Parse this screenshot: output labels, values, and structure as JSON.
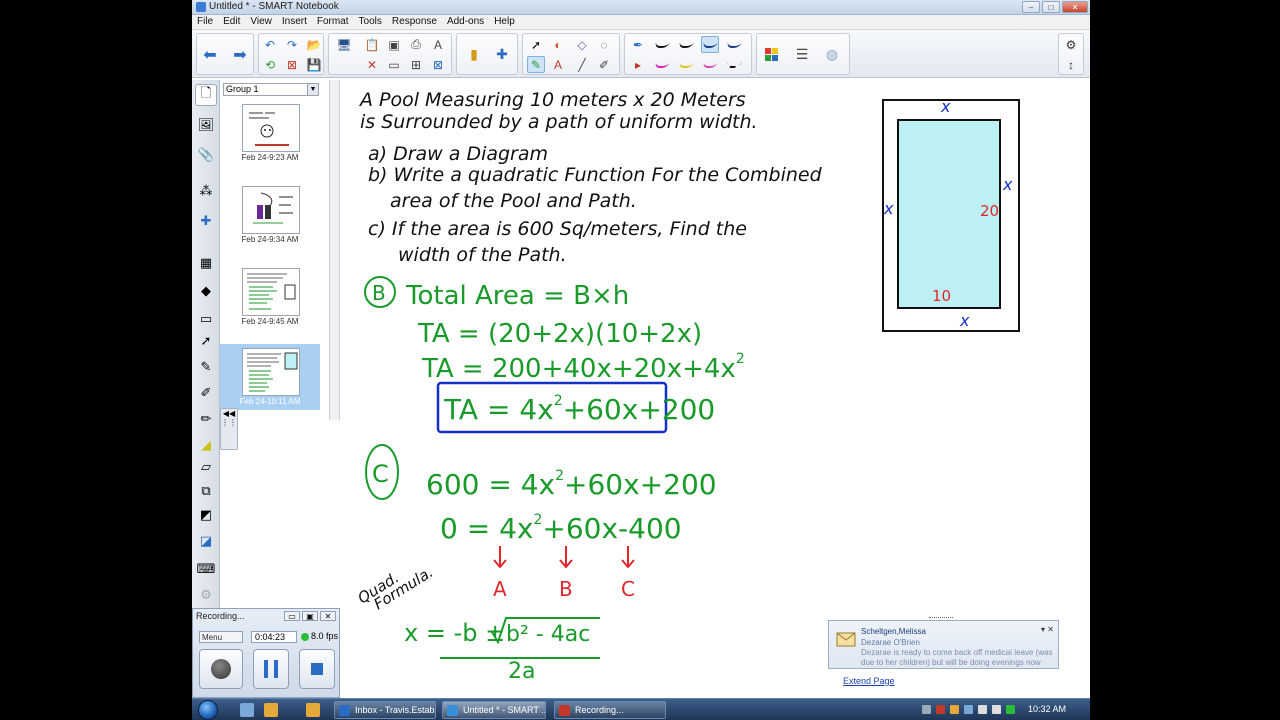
{
  "window": {
    "title": "Untitled * - SMART Notebook",
    "minimize": "–",
    "maximize": "□",
    "close": "✕"
  },
  "menu": [
    "File",
    "Edit",
    "View",
    "Insert",
    "Format",
    "Tools",
    "Response",
    "Add-ons",
    "Help"
  ],
  "sorter": {
    "group": "Group 1",
    "pages": [
      {
        "date": "Feb 24-9:23 AM"
      },
      {
        "date": "Feb 24-9:34 AM"
      },
      {
        "date": "Feb 24-9:45 AM"
      },
      {
        "date": "Feb 24-10:11 AM"
      }
    ],
    "selected_index": 3
  },
  "canvas": {
    "extend_page": "Extend Page",
    "problem": {
      "line1": "A Pool Measuring 10 meters x 20 Meters",
      "line2": "is Surrounded by a path of uniform width.",
      "a": "a) Draw a Diagram",
      "b1": "b) Write a quadratic Function For the Combined",
      "b2": "area of the Pool and Path.",
      "c1": "c) If the area is 600 Sq/meters, Find the",
      "c2": "width of the Path."
    },
    "diagram": {
      "x_label": "x",
      "length": "20",
      "width": "10"
    },
    "part_b": {
      "marker": "B",
      "l1": "Total Area = B×h",
      "l2": "TA = (20+2x)(10+2x)",
      "l3_main": "TA = 200+40x+20x+4x",
      "l3_exp": "2",
      "boxed_pre": "TA = 4x",
      "boxed_exp": "2",
      "boxed_post": "+60x+200"
    },
    "part_c": {
      "marker": "C",
      "l1_pre": "600 = 4x",
      "l1_exp": "2",
      "l1_post": "+60x+200",
      "l2_pre": "0 = 4x",
      "l2_exp": "2",
      "l2_post": "+60x-400",
      "a": "A",
      "b": "B",
      "c": "C"
    },
    "formula": {
      "label1": "Quad.",
      "label2": "Formula.",
      "numerator_pre": "x = -b ±",
      "radicand": "b² - 4ac",
      "denominator": "2a"
    }
  },
  "recorder": {
    "title": "Recording...",
    "menu": "Menu",
    "time": "0:04:23",
    "fps": "8.0 fps"
  },
  "notification": {
    "from": "Scheltgen,Melissa",
    "sender": "Dezarae O'Brien",
    "message": "Dezarae is ready to come back off medical leave (was due to her children) but will be doing evenings now"
  },
  "taskbar": {
    "tasks": [
      {
        "label": "Inbox - Travis.Estabr...",
        "color": "#2a6cc4"
      },
      {
        "label": "Untitled * - SMART ...",
        "color": "#3a8fd8"
      },
      {
        "label": "Recording...",
        "color": "#c0392b"
      }
    ],
    "clock": "10:32 AM"
  },
  "colors": {
    "ink_black": "#111111",
    "ink_green": "#1a9a2a",
    "ink_blue": "#1530c8",
    "ink_red": "#e0282a",
    "pool": "#bdf0f2"
  }
}
